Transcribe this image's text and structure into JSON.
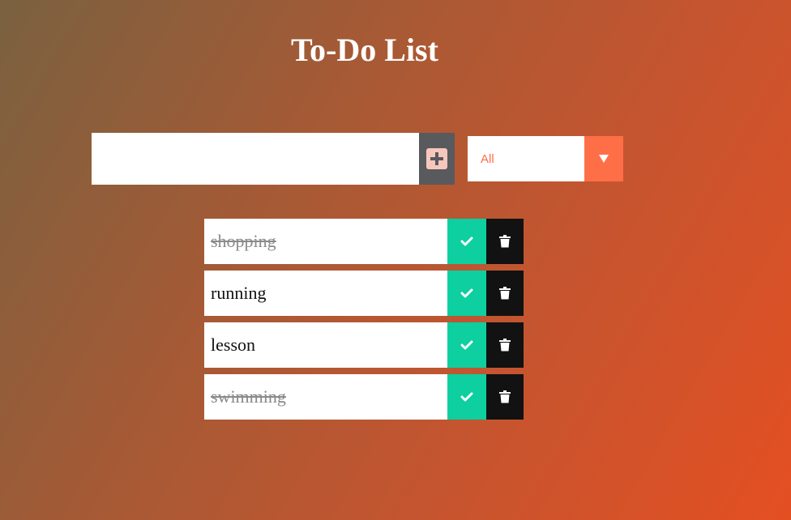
{
  "header": {
    "title": "To-Do List"
  },
  "form": {
    "input_value": "",
    "add_icon": "plus-square-icon",
    "filter": {
      "selected": "All",
      "arrow_icon": "caret-down-icon"
    }
  },
  "todos": [
    {
      "text": "shopping",
      "completed": true
    },
    {
      "text": "running",
      "completed": false
    },
    {
      "text": "lesson",
      "completed": false
    },
    {
      "text": "swimming",
      "completed": true
    }
  ],
  "icons": {
    "complete": "check-icon",
    "delete": "trash-icon"
  },
  "colors": {
    "accent": "#ff6f47",
    "complete": "#0dcfa0",
    "trash": "#121212",
    "add_button": "#585a5d"
  }
}
